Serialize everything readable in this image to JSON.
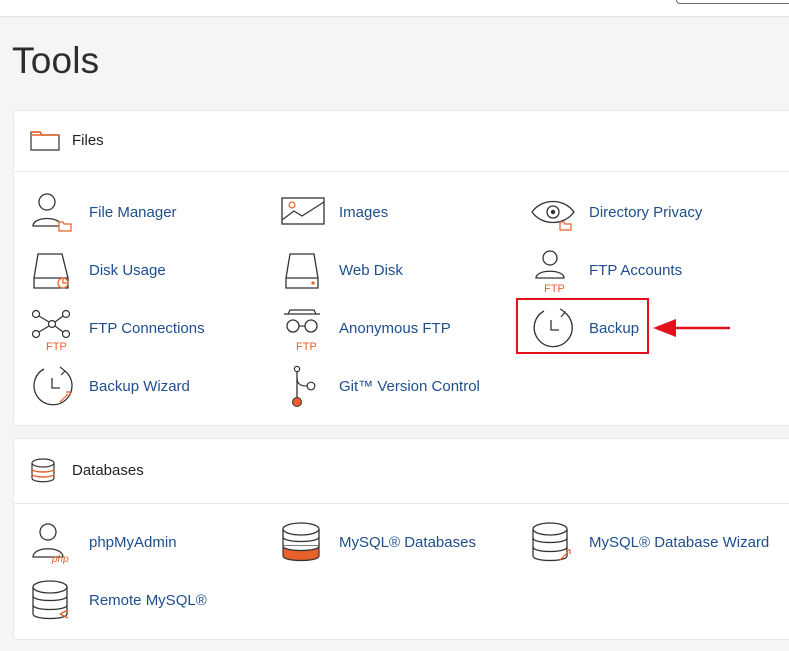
{
  "page": {
    "title": "Tools"
  },
  "sections": {
    "files": {
      "title": "Files",
      "items": {
        "file_manager": "File Manager",
        "images": "Images",
        "directory_privacy": "Directory Privacy",
        "disk_usage": "Disk Usage",
        "web_disk": "Web Disk",
        "ftp_accounts": "FTP Accounts",
        "ftp_connections": "FTP Connections",
        "anonymous_ftp": "Anonymous FTP",
        "backup": "Backup",
        "backup_wizard": "Backup Wizard",
        "git_version_control": "Git™ Version Control"
      }
    },
    "databases": {
      "title": "Databases",
      "items": {
        "phpmyadmin": "phpMyAdmin",
        "mysql_databases": "MySQL® Databases",
        "mysql_database_wizard": "MySQL® Database Wizard",
        "remote_mysql": "Remote MySQL®"
      }
    }
  },
  "icon_text": {
    "ftp": "FTP",
    "php": "php"
  },
  "colors": {
    "accent_orange": "#e8602c",
    "link_blue": "#1f4e8c",
    "annotation_red": "#e3101b"
  },
  "annotation": {
    "highlighted_item": "Backup"
  }
}
